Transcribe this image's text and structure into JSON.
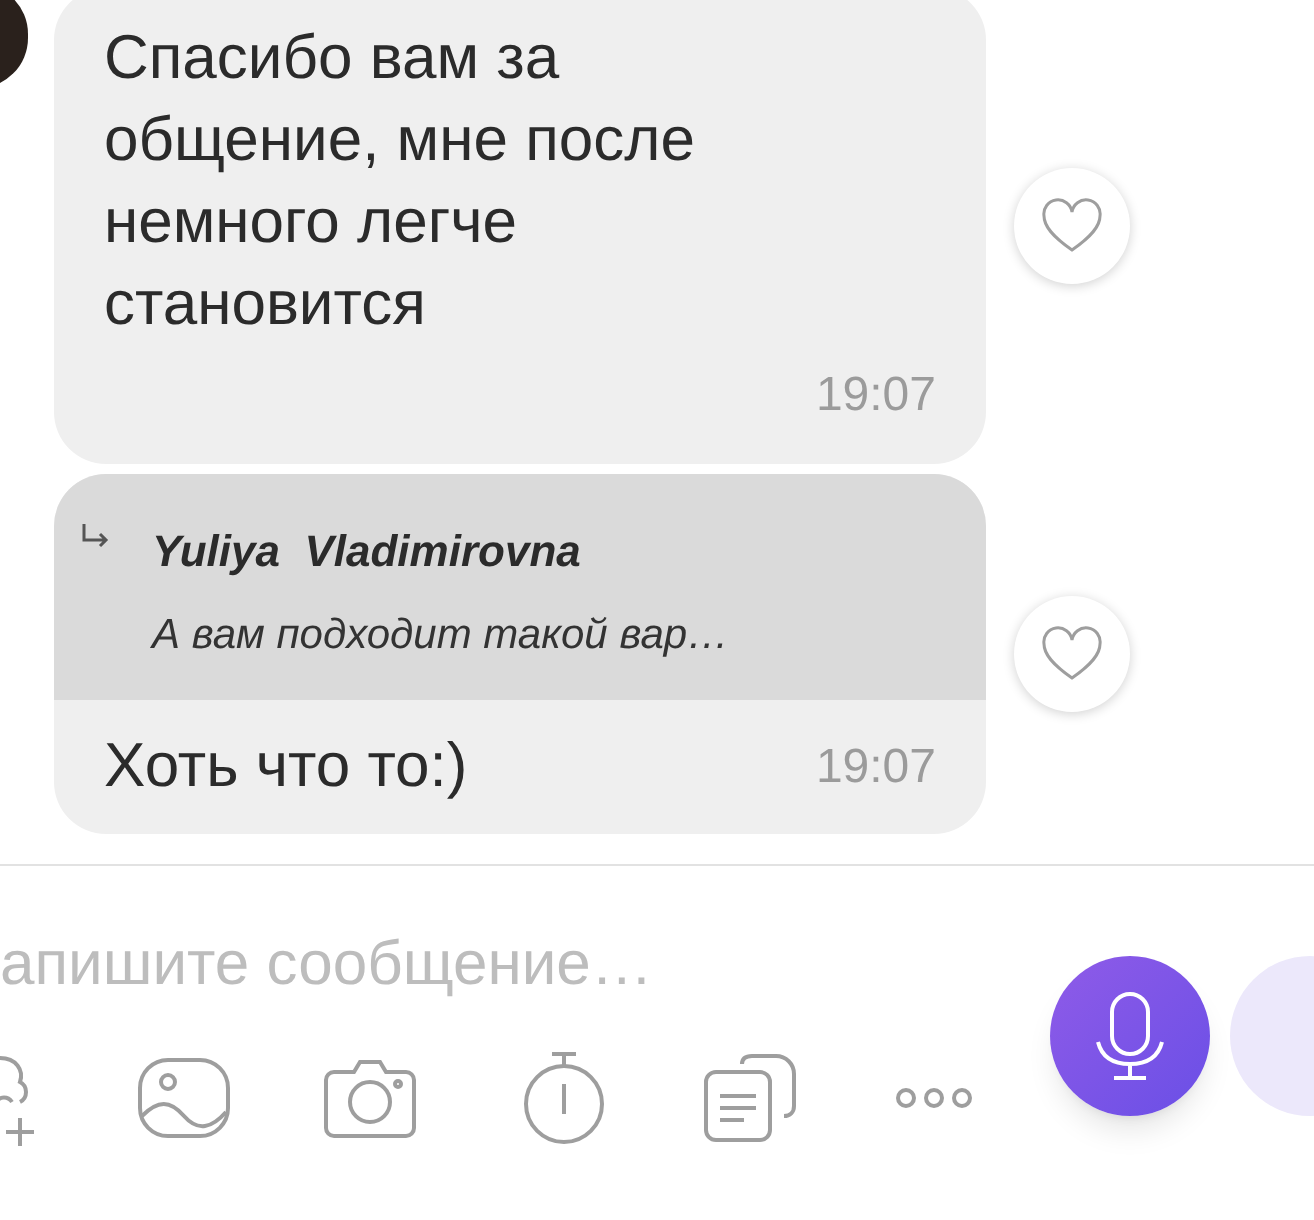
{
  "messages": [
    {
      "kind": "text",
      "text": "Спасибо вам за общение, мне после немного легче становится",
      "time": "19:07",
      "liked": false
    },
    {
      "kind": "reply",
      "quote": {
        "author": "Yuliya  Vladimirovna",
        "text": "А вам подходит такой вар…"
      },
      "text": "Хоть что то:)",
      "time": "19:07",
      "liked": false
    }
  ],
  "composer": {
    "placeholder": "апишите сообщение…"
  }
}
